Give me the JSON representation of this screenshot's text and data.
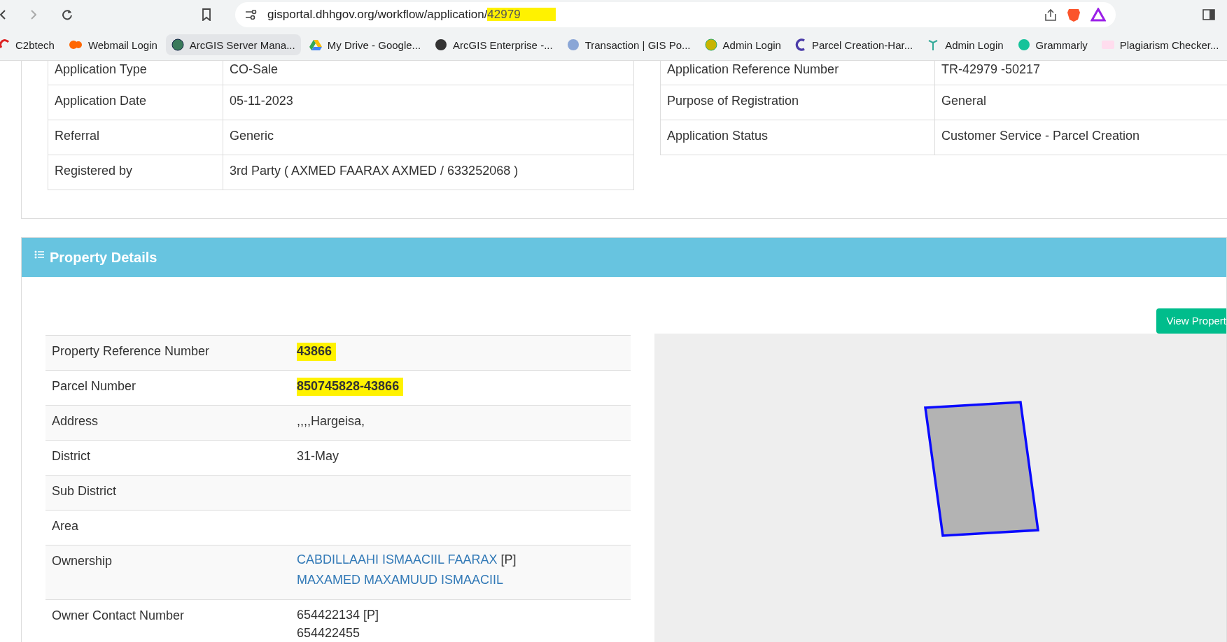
{
  "browser": {
    "url_base": "gisportal.dhhgov.org/workflow/application/",
    "url_highlight": "42979",
    "bookmarks": [
      {
        "label": "C2btech",
        "selected": false
      },
      {
        "label": "Webmail Login",
        "selected": false
      },
      {
        "label": "ArcGIS Server Mana...",
        "selected": true
      },
      {
        "label": "My Drive - Google...",
        "selected": false
      },
      {
        "label": "ArcGIS Enterprise -...",
        "selected": false
      },
      {
        "label": "Transaction | GIS Po...",
        "selected": false
      },
      {
        "label": "Admin Login",
        "selected": false
      },
      {
        "label": "Parcel Creation-Har...",
        "selected": false
      },
      {
        "label": "Admin Login",
        "selected": false
      },
      {
        "label": "Grammarly",
        "selected": false
      },
      {
        "label": "Plagiarism Checker...",
        "selected": false
      }
    ]
  },
  "application": {
    "left": [
      {
        "label": "Application Type",
        "value": "CO-Sale"
      },
      {
        "label": "Application Date",
        "value": "05-11-2023"
      },
      {
        "label": "Referral",
        "value": "Generic"
      },
      {
        "label": "Registered by",
        "value": "3rd Party ( AXMED FAARAX AXMED / 633252068 )"
      }
    ],
    "right": [
      {
        "label": "Application Reference Number",
        "value": "TR-42979 -50217"
      },
      {
        "label": "Purpose of Registration",
        "value": "General"
      },
      {
        "label": "Application Status",
        "value": "Customer Service - Parcel Creation"
      }
    ]
  },
  "property": {
    "title": "Property Details",
    "button": "View Propert",
    "rows": [
      {
        "label": "Property Reference Number",
        "value": "43866",
        "highlighted": true
      },
      {
        "label": "Parcel Number",
        "value": "850745828-43866",
        "highlighted": true
      },
      {
        "label": "Address",
        "value": ",,,,Hargeisa,",
        "highlighted": false
      },
      {
        "label": "District",
        "value": "31-May",
        "highlighted": false
      },
      {
        "label": "Sub District"
      },
      {
        "label": "Area"
      },
      {
        "label": "Ownership",
        "owners": [
          {
            "name": "CABDILLAAHI ISMAACIIL FAARAX",
            "tag": "[P]"
          },
          {
            "name": "MAXAMED MAXAMUUD ISMAACIIL"
          }
        ]
      },
      {
        "label": "Owner Contact Number",
        "lines": [
          "654422134 [P]",
          "654422455"
        ]
      }
    ]
  }
}
